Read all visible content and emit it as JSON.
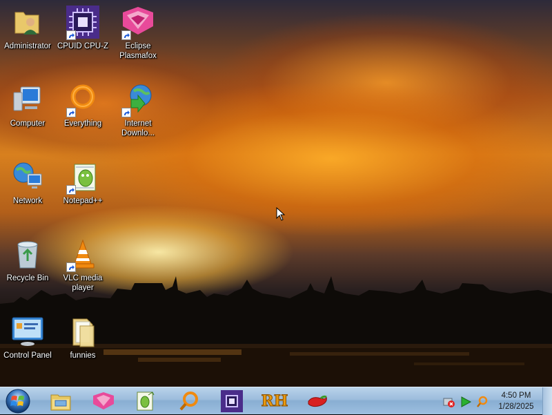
{
  "desktop": {
    "icons": [
      {
        "label": "Administrator"
      },
      {
        "label": "Computer"
      },
      {
        "label": "Network"
      },
      {
        "label": "Recycle Bin"
      },
      {
        "label": "Control Panel"
      },
      {
        "label": "CPUID CPU-Z"
      },
      {
        "label": "Everything"
      },
      {
        "label": "Notepad++"
      },
      {
        "label": "VLC media player"
      },
      {
        "label": "funnies"
      },
      {
        "label": "Eclipse Plasmafox"
      },
      {
        "label": "Internet Downlo..."
      }
    ]
  },
  "taskbar": {
    "start_icon": "windows-orb-icon",
    "pinned": [
      {
        "icon": "file-explorer-icon"
      },
      {
        "icon": "plasmafox-icon"
      },
      {
        "icon": "notepadpp-icon"
      },
      {
        "icon": "everything-icon"
      },
      {
        "icon": "cpuz-icon"
      },
      {
        "icon": "resource-hacker-icon",
        "text": "RH"
      },
      {
        "icon": "chili-pepper-icon"
      }
    ],
    "tray": {
      "icons": [
        "network-error-icon",
        "media-play-icon",
        "everything-tray-icon"
      ],
      "time": "4:50 PM",
      "date": "1/28/2025"
    }
  },
  "colors": {
    "taskbar_gradient_top": "#b9d3ea",
    "taskbar_gradient_bottom": "#9dbfe0",
    "label_text": "#ffffff"
  }
}
